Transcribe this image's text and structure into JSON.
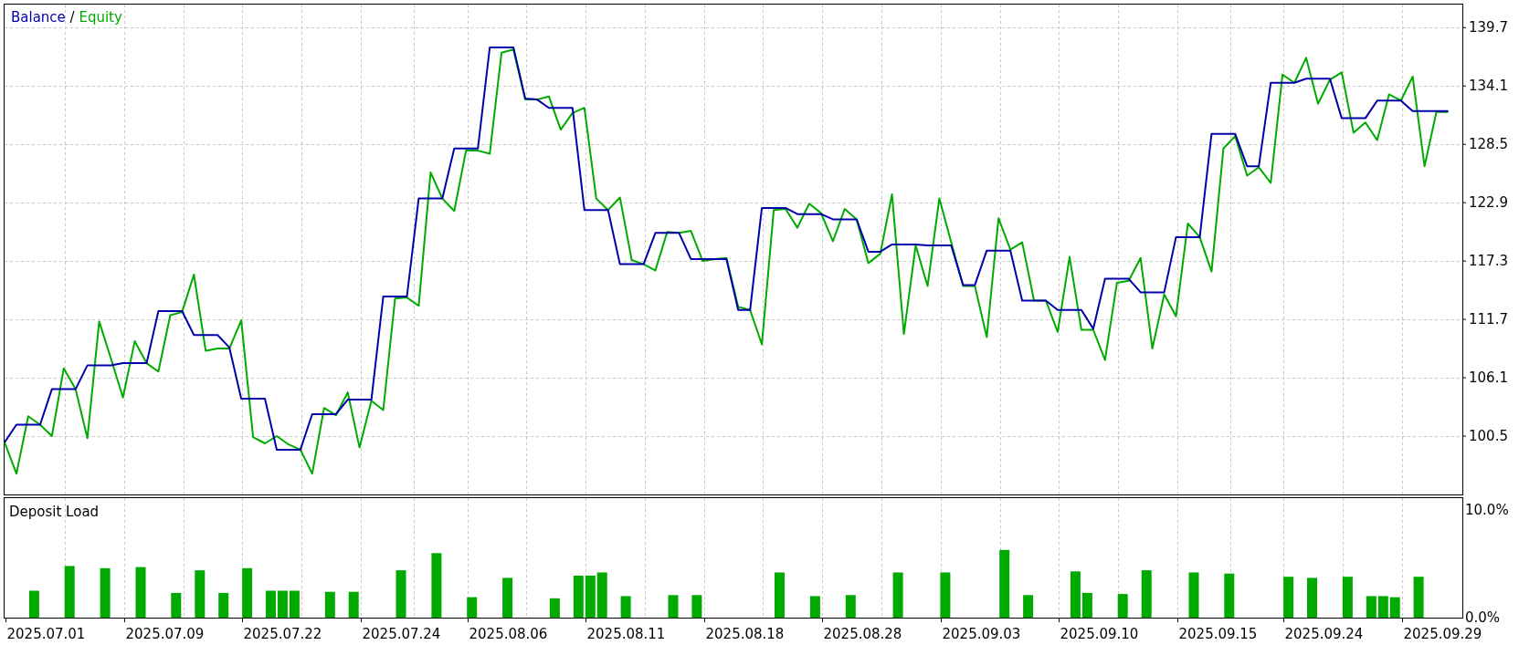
{
  "equity_chart": {
    "legend_separator": "/",
    "chart_data": {
      "type": "line",
      "series": [
        {
          "name": "Balance",
          "color": "#0000aa",
          "values": [
            99.9,
            101.6,
            101.6,
            101.6,
            105.0,
            105.0,
            105.0,
            107.3,
            107.3,
            107.3,
            107.5,
            107.5,
            107.5,
            112.5,
            112.5,
            112.5,
            110.2,
            110.2,
            110.2,
            109.0,
            104.1,
            104.1,
            104.1,
            99.2,
            99.2,
            99.2,
            102.6,
            102.6,
            102.6,
            104.0,
            104.0,
            104.0,
            113.9,
            113.9,
            113.9,
            123.3,
            123.3,
            123.3,
            128.1,
            128.1,
            128.1,
            137.8,
            137.8,
            137.8,
            132.9,
            132.8,
            132.0,
            132.0,
            132.0,
            122.2,
            122.2,
            122.2,
            117.0,
            117.0,
            117.0,
            120.0,
            120.0,
            120.0,
            117.5,
            117.5,
            117.5,
            117.5,
            112.6,
            112.6,
            122.4,
            122.4,
            122.4,
            121.8,
            121.8,
            121.8,
            121.3,
            121.3,
            121.3,
            118.2,
            118.2,
            118.9,
            118.9,
            118.9,
            118.8,
            118.8,
            118.8,
            115.0,
            115.0,
            118.3,
            118.3,
            118.3,
            113.5,
            113.5,
            113.5,
            112.6,
            112.6,
            112.6,
            110.8,
            115.6,
            115.6,
            115.6,
            114.3,
            114.3,
            114.3,
            119.6,
            119.6,
            119.6,
            129.5,
            129.5,
            129.5,
            126.4,
            126.4,
            134.4,
            134.4,
            134.4,
            134.8,
            134.8,
            134.8,
            131.0,
            131.0,
            131.0,
            132.7,
            132.7,
            132.7,
            131.7,
            131.7,
            131.7,
            131.7
          ]
        },
        {
          "name": "Equity",
          "color": "#00aa00",
          "values": [
            99.9,
            96.9,
            102.4,
            101.6,
            100.5,
            107.0,
            105.0,
            100.3,
            111.5,
            107.9,
            104.2,
            109.6,
            107.5,
            106.7,
            112.1,
            112.4,
            116.0,
            108.7,
            108.9,
            108.9,
            111.6,
            100.4,
            99.8,
            100.5,
            99.7,
            99.2,
            96.9,
            103.2,
            102.5,
            104.7,
            99.4,
            103.9,
            103.0,
            113.7,
            113.8,
            113.0,
            125.8,
            123.3,
            122.1,
            127.9,
            127.9,
            127.6,
            137.3,
            137.6,
            132.8,
            132.8,
            133.1,
            129.9,
            131.5,
            132.0,
            123.3,
            122.2,
            123.4,
            117.4,
            117.0,
            116.4,
            120.1,
            120.0,
            120.2,
            117.3,
            117.5,
            117.6,
            112.9,
            112.6,
            109.3,
            122.2,
            122.3,
            120.5,
            122.8,
            121.9,
            119.2,
            122.3,
            121.3,
            117.1,
            118.0,
            123.7,
            110.3,
            118.8,
            114.9,
            123.3,
            119.1,
            114.9,
            114.9,
            110.0,
            121.4,
            118.4,
            119.1,
            113.5,
            113.5,
            110.5,
            117.7,
            110.7,
            110.7,
            107.8,
            115.2,
            115.4,
            117.6,
            108.9,
            114.1,
            112.0,
            120.9,
            119.6,
            116.3,
            128.1,
            129.3,
            125.5,
            126.3,
            124.8,
            135.2,
            134.4,
            136.8,
            132.4,
            134.7,
            135.4,
            129.6,
            130.6,
            128.9,
            133.3,
            132.7,
            135.0,
            126.4,
            131.6,
            131.6
          ]
        }
      ],
      "grid": true,
      "ylim": [
        94.9,
        142.0
      ],
      "yticks": [
        100.5,
        106.1,
        111.7,
        117.3,
        122.9,
        128.5,
        134.1,
        139.7
      ]
    }
  },
  "deposit_load": {
    "chart_data": {
      "type": "bar",
      "title": "Deposit Load",
      "grid": true,
      "categories": [
        null,
        null,
        null,
        "2025.07.01",
        null,
        null,
        null,
        null,
        null,
        null,
        null,
        null,
        null,
        "2025.07.09",
        null,
        null,
        null,
        null,
        null,
        null,
        null,
        null,
        null,
        "2025.07.22",
        null,
        null,
        null,
        null,
        null,
        null,
        null,
        null,
        null,
        "2025.07.24",
        null,
        null,
        null,
        null,
        null,
        null,
        null,
        null,
        "2025.08.06",
        null,
        null,
        null,
        null,
        null,
        null,
        null,
        null,
        null,
        "2025.08.11",
        null,
        null,
        null,
        null,
        null,
        null,
        null,
        null,
        null,
        "2025.08.18",
        null,
        null,
        null,
        null,
        null,
        null,
        null,
        null,
        null,
        "2025.08.28",
        null,
        null,
        null,
        null,
        null,
        null,
        null,
        null,
        null,
        "2025.09.03",
        null,
        null,
        null,
        null,
        null,
        null,
        null,
        null,
        null,
        "2025.09.10",
        null,
        null,
        null,
        null,
        null,
        null,
        null,
        null,
        null,
        "2025.09.15",
        null,
        null,
        null,
        null,
        null,
        null,
        null,
        null,
        "2025.09.24",
        null,
        null,
        null,
        null,
        null,
        null,
        null,
        null,
        null,
        "2025.09.29",
        null
      ],
      "series": [
        {
          "color": "#00aa00",
          "values": [
            null,
            null,
            2.5,
            null,
            null,
            4.8,
            null,
            null,
            4.6,
            null,
            null,
            4.7,
            null,
            null,
            2.3,
            null,
            4.4,
            null,
            2.3,
            null,
            4.6,
            null,
            2.5,
            2.5,
            2.5,
            null,
            null,
            2.4,
            null,
            2.4,
            null,
            null,
            null,
            4.4,
            null,
            null,
            6.0,
            null,
            null,
            1.9,
            null,
            null,
            3.7,
            null,
            null,
            null,
            1.8,
            null,
            3.9,
            3.9,
            4.2,
            null,
            2.0,
            null,
            null,
            null,
            2.1,
            null,
            2.1,
            null,
            null,
            null,
            null,
            null,
            null,
            4.2,
            null,
            null,
            2.0,
            null,
            null,
            2.1,
            null,
            null,
            null,
            4.2,
            null,
            null,
            null,
            4.2,
            null,
            null,
            null,
            null,
            6.3,
            null,
            2.1,
            null,
            null,
            null,
            4.3,
            2.3,
            null,
            null,
            2.2,
            null,
            4.4,
            null,
            null,
            null,
            4.2,
            null,
            null,
            4.1,
            null,
            null,
            null,
            null,
            3.8,
            null,
            3.7,
            null,
            null,
            3.8,
            null,
            2.0,
            2.0,
            1.9,
            null,
            3.8,
            null,
            null,
            null
          ]
        }
      ],
      "ylim": [
        0,
        11.2
      ],
      "yticks": [
        {
          "value": 0,
          "label": "0.0%"
        },
        {
          "value": 10,
          "label": "10.0%"
        }
      ]
    }
  }
}
